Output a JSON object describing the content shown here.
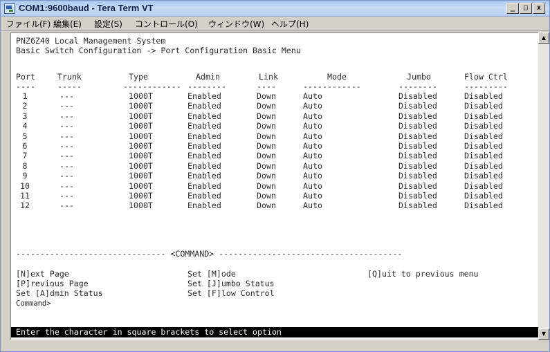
{
  "window": {
    "title": "COM1:9600baud - Tera Term VT"
  },
  "menu": {
    "items": [
      "ファイル(F)",
      "編集(E)",
      "設定(S)",
      "コントロール(O)",
      "ウィンドウ(W)",
      "ヘルプ(H)"
    ]
  },
  "terminal": {
    "heading1": "PNZ6Z40 Local Management System",
    "heading2": "Basic Switch Configuration -> Port Configuration Basic Menu",
    "columns": [
      "Port",
      "Trunk",
      "Type",
      "Admin",
      "Link",
      "Mode",
      "Jumbo",
      "Flow Ctrl"
    ],
    "underlines": [
      "----",
      "-----",
      "------------",
      "--------",
      "----",
      "------------",
      "--------",
      "---------"
    ],
    "rows": [
      [
        "1",
        "---",
        "1000T",
        "Enabled",
        "Down",
        "Auto",
        "Disabled",
        "Disabled"
      ],
      [
        "2",
        "---",
        "1000T",
        "Enabled",
        "Down",
        "Auto",
        "Disabled",
        "Disabled"
      ],
      [
        "3",
        "---",
        "1000T",
        "Enabled",
        "Down",
        "Auto",
        "Disabled",
        "Disabled"
      ],
      [
        "4",
        "---",
        "1000T",
        "Enabled",
        "Down",
        "Auto",
        "Disabled",
        "Disabled"
      ],
      [
        "5",
        "---",
        "1000T",
        "Enabled",
        "Down",
        "Auto",
        "Disabled",
        "Disabled"
      ],
      [
        "6",
        "---",
        "1000T",
        "Enabled",
        "Down",
        "Auto",
        "Disabled",
        "Disabled"
      ],
      [
        "7",
        "---",
        "1000T",
        "Enabled",
        "Down",
        "Auto",
        "Disabled",
        "Disabled"
      ],
      [
        "8",
        "---",
        "1000T",
        "Enabled",
        "Down",
        "Auto",
        "Disabled",
        "Disabled"
      ],
      [
        "9",
        "---",
        "1000T",
        "Enabled",
        "Down",
        "Auto",
        "Disabled",
        "Disabled"
      ],
      [
        "10",
        "---",
        "1000T",
        "Enabled",
        "Down",
        "Auto",
        "Disabled",
        "Disabled"
      ],
      [
        "11",
        "---",
        "1000T",
        "Enabled",
        "Down",
        "Auto",
        "Disabled",
        "Disabled"
      ],
      [
        "12",
        "---",
        "1000T",
        "Enabled",
        "Down",
        "Auto",
        "Disabled",
        "Disabled"
      ]
    ],
    "separator": "------------------------------- <COMMAND> --------------------------------------",
    "commands": {
      "next_page": "[N]ext Page",
      "previous_page": "[P]revious Page",
      "set_admin": "Set [A]dmin Status",
      "set_mode": "Set [M]ode",
      "set_jumbo": "Set [J]umbo Status",
      "set_flow": "Set [F]low Control",
      "quit": "[Q]uit to previous menu"
    },
    "prompt": "Command>",
    "status": "Enter the character in square brackets to select option"
  },
  "scrollbar": {
    "up_icon": "▲",
    "down_icon": "▼"
  },
  "window_buttons": {
    "minimize": "_",
    "maximize": "□",
    "close": "x"
  }
}
